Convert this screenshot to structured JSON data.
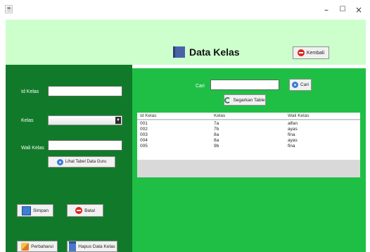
{
  "window": {
    "app_icon": "java-app-icon",
    "controls": {
      "minimize": "–",
      "maximize": "☐",
      "close": "×"
    }
  },
  "header": {
    "title": "Data Kelas",
    "title_icon": "book-icon",
    "back_label": "Kembali",
    "background": "#ccffcc"
  },
  "form": {
    "id_label": "Id Kelas",
    "id_value": "",
    "kelas_label": "Kelas",
    "kelas_selected": "",
    "wali_label": "Wali Kelas",
    "wali_value": "",
    "guru_button": "Lihat Tabel Data Guru",
    "background": "#117a2a"
  },
  "actions": {
    "save": "Simpan",
    "cancel": "Batal",
    "update": "Perbaharui",
    "delete": "Hapus Data Kelas"
  },
  "search": {
    "label": "Cari",
    "value": "",
    "button": "Cari",
    "refresh_button": "Segarkan Table"
  },
  "table": {
    "background": "#1fbf46",
    "columns": [
      "Id Kelas",
      "Kelas",
      "Wali Kelas"
    ],
    "rows": [
      [
        "001",
        "7a",
        "alfan"
      ],
      [
        "002",
        "7b",
        "ayas"
      ],
      [
        "003",
        "8a",
        "fina"
      ],
      [
        "004",
        "8a",
        "ayas"
      ],
      [
        "005",
        "9b",
        "fina"
      ]
    ]
  }
}
